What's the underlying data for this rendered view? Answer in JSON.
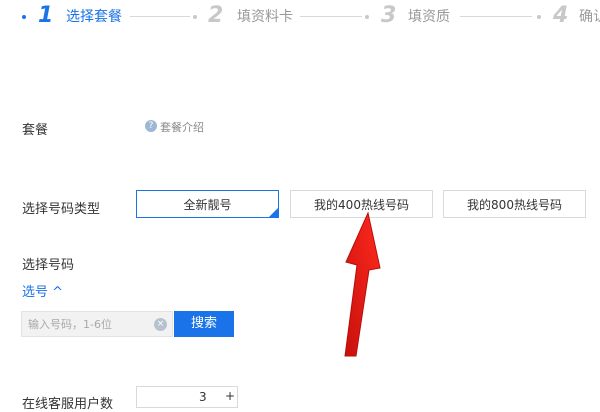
{
  "steps": [
    {
      "number": "1",
      "label": "选择套餐"
    },
    {
      "number": "2",
      "label": "填资料卡"
    },
    {
      "number": "3",
      "label": "填资质"
    },
    {
      "number": "4",
      "label": "确认"
    }
  ],
  "package": {
    "label": "套餐",
    "intro_link": "套餐介绍",
    "help_icon": "?"
  },
  "number_type": {
    "label": "选择号码类型",
    "options": [
      "全新靓号",
      "我的400热线号码",
      "我的800热线号码"
    ],
    "selected": "全新靓号"
  },
  "select_number": {
    "label": "选择号码",
    "toggle_link": "选号 ^"
  },
  "search": {
    "placeholder": "输入号码，1-6位",
    "clear_icon": "×",
    "button": "搜索"
  },
  "bottom": {
    "label": "在线客服用户数",
    "stepper_value": "3",
    "stepper_plus": "+"
  },
  "colors": {
    "active": "#1a73e8",
    "inactive": "#c8c8c8",
    "annotation_arrow": "#e8201a"
  }
}
